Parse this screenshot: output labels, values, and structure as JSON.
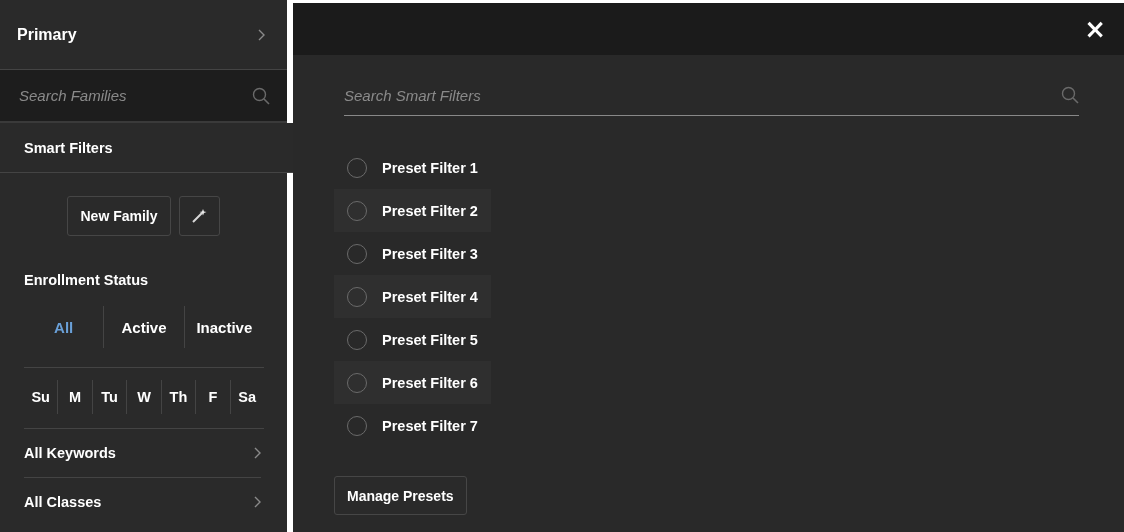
{
  "sidebar": {
    "header": {
      "title": "Primary"
    },
    "search": {
      "placeholder": "Search Families"
    },
    "section": {
      "label": "Smart Filters",
      "selected": true
    },
    "buttons": {
      "new_family": "New Family"
    },
    "enrollment": {
      "title": "Enrollment Status",
      "options": [
        {
          "label": "All",
          "selected": true
        },
        {
          "label": "Active",
          "selected": false
        },
        {
          "label": "Inactive",
          "selected": false
        }
      ]
    },
    "days": [
      {
        "label": "Su"
      },
      {
        "label": "M"
      },
      {
        "label": "Tu"
      },
      {
        "label": "W"
      },
      {
        "label": "Th"
      },
      {
        "label": "F"
      },
      {
        "label": "Sa"
      }
    ],
    "links": [
      {
        "label": "All Keywords"
      },
      {
        "label": "All Classes"
      }
    ]
  },
  "panel": {
    "close": "×",
    "search": {
      "placeholder": "Search Smart Filters"
    },
    "presets": [
      {
        "label": "Preset Filter 1",
        "selected": false
      },
      {
        "label": "Preset Filter 2",
        "selected": false
      },
      {
        "label": "Preset Filter 3",
        "selected": false
      },
      {
        "label": "Preset Filter 4",
        "selected": false
      },
      {
        "label": "Preset Filter 5",
        "selected": false
      },
      {
        "label": "Preset Filter 6",
        "selected": false
      },
      {
        "label": "Preset Filter 7",
        "selected": false
      }
    ],
    "manage_button": "Manage Presets"
  }
}
